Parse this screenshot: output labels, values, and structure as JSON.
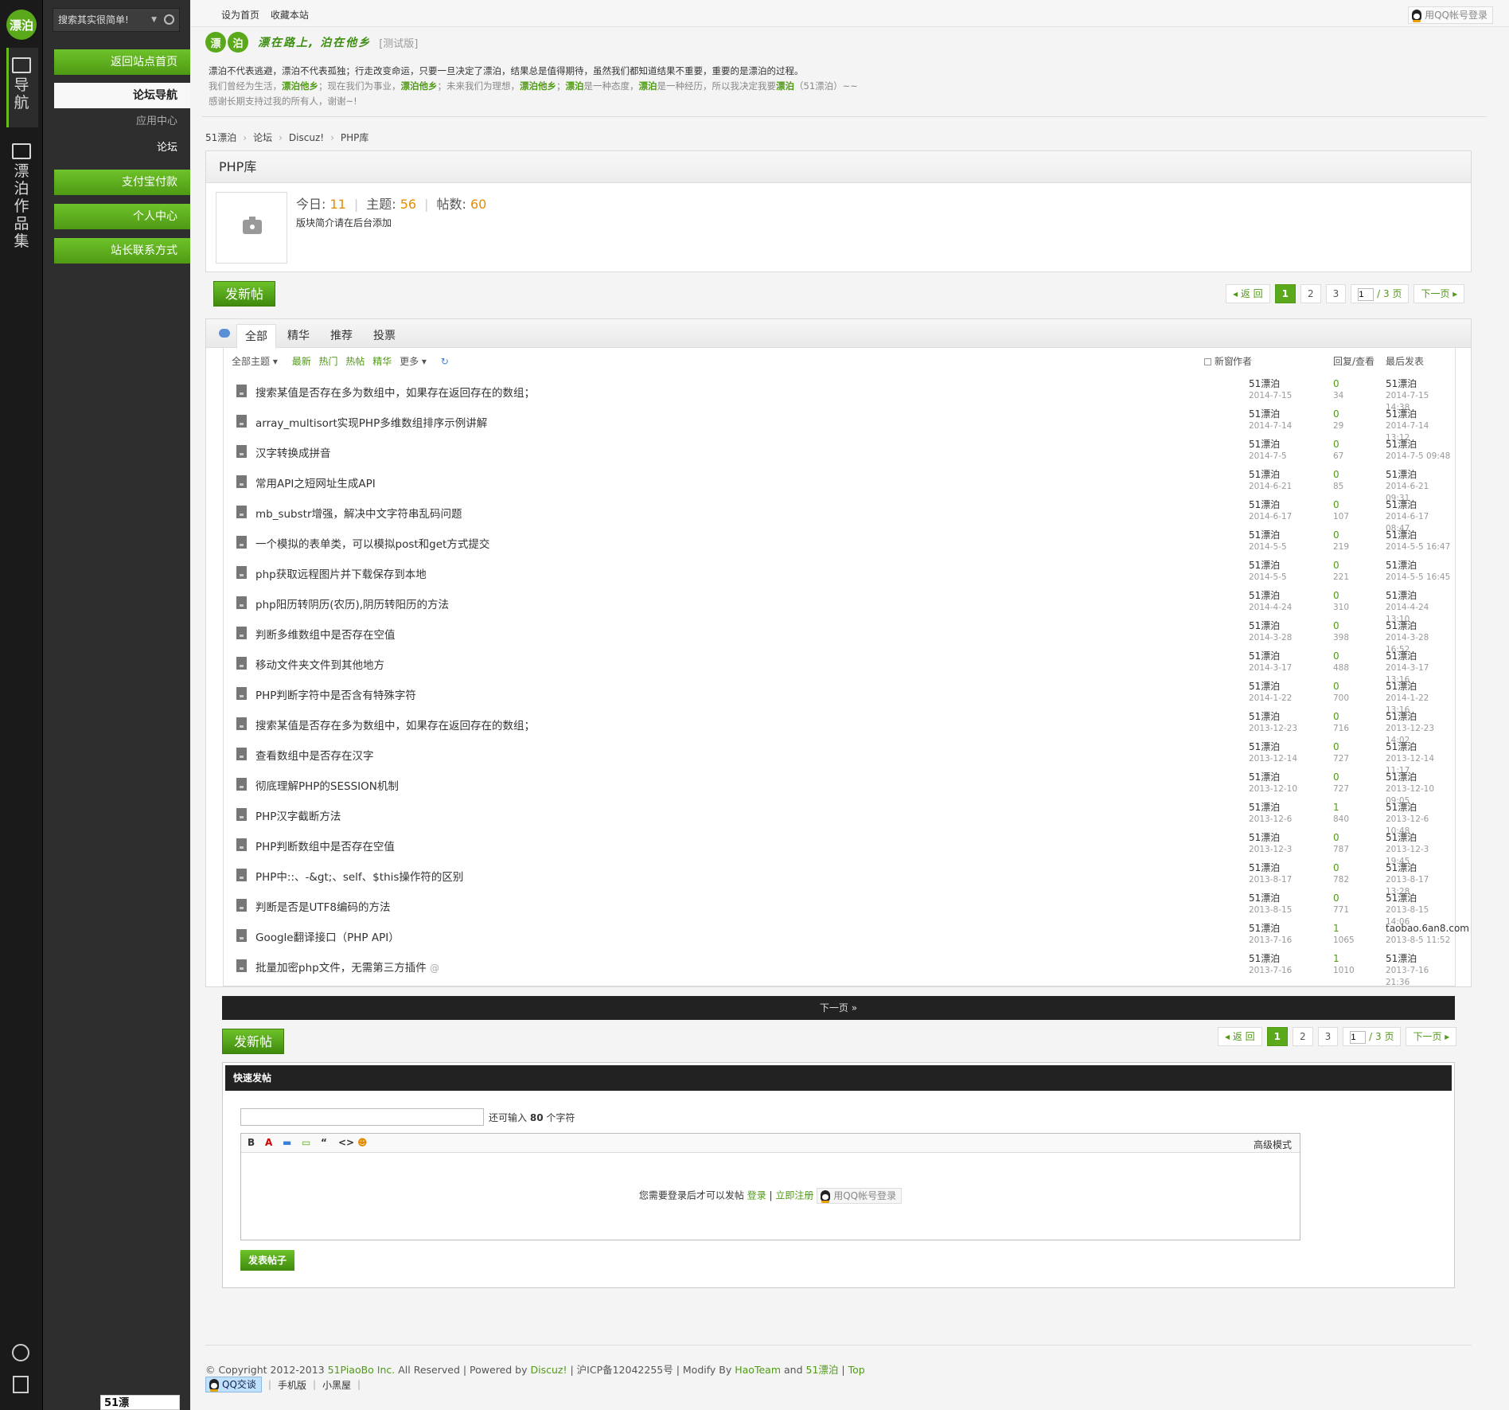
{
  "strip": {
    "logo_text": "漂泊",
    "nav_label": [
      "导",
      "航"
    ],
    "works_label": [
      "漂",
      "泊",
      "作",
      "品",
      "集"
    ]
  },
  "sidebar": {
    "search_placeholder": "搜索其实很简单!",
    "items": [
      {
        "label": "返回站点首页",
        "style": "green"
      },
      {
        "label": "论坛导航",
        "style": "white"
      },
      {
        "label": "应用中心",
        "style": "sub"
      },
      {
        "label": "论坛",
        "style": "sub-active"
      },
      {
        "label": "支付宝付款",
        "style": "green"
      },
      {
        "label": "个人中心",
        "style": "green"
      },
      {
        "label": "站长联系方式",
        "style": "green"
      }
    ],
    "bottom_thumb": "51漂"
  },
  "topbar": {
    "set_home": "设为首页",
    "bookmark": "收藏本站",
    "qq_login": "用QQ帐号登录"
  },
  "header": {
    "logo_chars": [
      "漂",
      "泊"
    ],
    "slogan": "漂在路上, 泊在他乡",
    "beta": "[测试版]",
    "notice_line1": "漂泊不代表逃避，漂泊不代表孤独；行走改变命运，只要一旦决定了漂泊，结果总是值得期待，虽然我们都知道结果不重要，重要的是漂泊的过程。",
    "notice_line2_parts": [
      "我们曾经为生活，",
      "漂泊他乡",
      "；现在我们为事业，",
      "漂泊他乡",
      "；未来我们为理想，",
      "漂泊他乡",
      "；",
      "漂泊",
      "是一种态度，",
      "漂泊",
      "是一种经历，所以我决定我要",
      "漂泊",
      "（51漂泊）~~"
    ],
    "notice_line3": "感谢长期支持过我的所有人，谢谢~!"
  },
  "breadcrumb": [
    "51漂泊",
    "论坛",
    "Discuz!",
    "PHP库"
  ],
  "forum": {
    "title": "PHP库",
    "today_label": "今日:",
    "today": "11",
    "threads_label": "主题:",
    "threads": "56",
    "posts_label": "帖数:",
    "posts": "60",
    "description": "版块简介请在后台添加"
  },
  "new_thread_label": "发新帖",
  "pager": {
    "back": "返 回",
    "pages": [
      "1",
      "2",
      "3"
    ],
    "current": "1",
    "input_value": "1",
    "total": "/ 3 页",
    "next": "下一页"
  },
  "tabs": [
    "全部",
    "精华",
    "推荐",
    "投票"
  ],
  "filters": {
    "all_topics": "全部主题",
    "links": [
      "最新",
      "热门",
      "热帖",
      "精华"
    ],
    "more": "更多",
    "new_window": "新窗",
    "col_author": "作者",
    "col_stats": "回复/查看",
    "col_last": "最后发表"
  },
  "threads": [
    {
      "title": "搜索某值是否存在多为数组中，如果存在返回存在的数组；",
      "author": "51漂泊",
      "date": "2014-7-15",
      "replies": "0",
      "views": "34",
      "last_user": "51漂泊",
      "last_time": "2014-7-15 14:38"
    },
    {
      "title": "array_multisort实现PHP多维数组排序示例讲解",
      "author": "51漂泊",
      "date": "2014-7-14",
      "replies": "0",
      "views": "29",
      "last_user": "51漂泊",
      "last_time": "2014-7-14 13:12"
    },
    {
      "title": "汉字转换成拼音",
      "author": "51漂泊",
      "date": "2014-7-5",
      "replies": "0",
      "views": "67",
      "last_user": "51漂泊",
      "last_time": "2014-7-5 09:48"
    },
    {
      "title": "常用API之短网址生成API",
      "author": "51漂泊",
      "date": "2014-6-21",
      "replies": "0",
      "views": "85",
      "last_user": "51漂泊",
      "last_time": "2014-6-21 09:31"
    },
    {
      "title": "mb_substr增强，解决中文字符串乱码问题",
      "author": "51漂泊",
      "date": "2014-6-17",
      "replies": "0",
      "views": "107",
      "last_user": "51漂泊",
      "last_time": "2014-6-17 08:47"
    },
    {
      "title": "一个模拟的表单类，可以模拟post和get方式提交",
      "author": "51漂泊",
      "date": "2014-5-5",
      "replies": "0",
      "views": "219",
      "last_user": "51漂泊",
      "last_time": "2014-5-5 16:47"
    },
    {
      "title": "php获取远程图片并下载保存到本地",
      "author": "51漂泊",
      "date": "2014-5-5",
      "replies": "0",
      "views": "221",
      "last_user": "51漂泊",
      "last_time": "2014-5-5 16:45"
    },
    {
      "title": "php阳历转阴历(农历),阴历转阳历的方法",
      "author": "51漂泊",
      "date": "2014-4-24",
      "replies": "0",
      "views": "310",
      "last_user": "51漂泊",
      "last_time": "2014-4-24 13:10"
    },
    {
      "title": "判断多维数组中是否存在空值",
      "author": "51漂泊",
      "date": "2014-3-28",
      "replies": "0",
      "views": "398",
      "last_user": "51漂泊",
      "last_time": "2014-3-28 16:52"
    },
    {
      "title": "移动文件夹文件到其他地方",
      "author": "51漂泊",
      "date": "2014-3-17",
      "replies": "0",
      "views": "488",
      "last_user": "51漂泊",
      "last_time": "2014-3-17 13:16"
    },
    {
      "title": "PHP判断字符中是否含有特殊字符",
      "author": "51漂泊",
      "date": "2014-1-22",
      "replies": "0",
      "views": "700",
      "last_user": "51漂泊",
      "last_time": "2014-1-22 13:16"
    },
    {
      "title": "搜索某值是否存在多为数组中，如果存在返回存在的数组；",
      "author": "51漂泊",
      "date": "2013-12-23",
      "replies": "0",
      "views": "716",
      "last_user": "51漂泊",
      "last_time": "2013-12-23 14:02"
    },
    {
      "title": "查看数组中是否存在汉字",
      "author": "51漂泊",
      "date": "2013-12-14",
      "replies": "0",
      "views": "727",
      "last_user": "51漂泊",
      "last_time": "2013-12-14 11:17"
    },
    {
      "title": "彻底理解PHP的SESSION机制",
      "author": "51漂泊",
      "date": "2013-12-10",
      "replies": "0",
      "views": "727",
      "last_user": "51漂泊",
      "last_time": "2013-12-10 09:05"
    },
    {
      "title": "PHP汉字截断方法",
      "author": "51漂泊",
      "date": "2013-12-6",
      "replies": "1",
      "views": "840",
      "last_user": "51漂泊",
      "last_time": "2013-12-6 10:48"
    },
    {
      "title": "PHP判断数组中是否存在空值",
      "author": "51漂泊",
      "date": "2013-12-3",
      "replies": "0",
      "views": "787",
      "last_user": "51漂泊",
      "last_time": "2013-12-3 19:45"
    },
    {
      "title": "PHP中::、-&gt;、self、$this操作符的区别",
      "author": "51漂泊",
      "date": "2013-8-17",
      "replies": "0",
      "views": "782",
      "last_user": "51漂泊",
      "last_time": "2013-8-17 13:28"
    },
    {
      "title": "判断是否是UTF8编码的方法",
      "author": "51漂泊",
      "date": "2013-8-15",
      "replies": "0",
      "views": "771",
      "last_user": "51漂泊",
      "last_time": "2013-8-15 14:06"
    },
    {
      "title": "Google翻译接口（PHP API）",
      "author": "51漂泊",
      "date": "2013-7-16",
      "replies": "1",
      "views": "1065",
      "last_user": "taobao.6an8.com",
      "last_time": "2013-8-5 11:52"
    },
    {
      "title": "批量加密php文件，无需第三方插件",
      "author": "51漂泊",
      "date": "2013-7-16",
      "replies": "1",
      "views": "1010",
      "last_user": "51漂泊",
      "last_time": "2013-7-16 21:36",
      "attach": "@"
    }
  ],
  "next_page_bar": "下一页 »",
  "quick_post": {
    "title": "快速发帖",
    "remain_prefix": "还可输入",
    "remain_count": "80",
    "remain_suffix": "个字符",
    "tools": [
      "B",
      "A",
      "▬",
      "▭",
      "“",
      "<>",
      "☻"
    ],
    "advanced": "高级模式",
    "login_msg": "您需要登录后才可以发帖",
    "login": "登录",
    "register": "立即注册",
    "qq_login": "用QQ帐号登录",
    "submit": "发表帖子"
  },
  "footer": {
    "copyright": "© Copyright 2012-2013",
    "company": "51PiaoBo Inc.",
    "reserved": "All Reserved | Powered by",
    "discuz": "Discuz!",
    "icp": "| 沪ICP备12042255号 | Modify By",
    "haoteam": "HaoTeam",
    "and": "and",
    "site": "51漂泊",
    "top": "Top",
    "qq_talk": "QQ交谈",
    "mobile": "手机版",
    "blackroom": "小黑屋"
  },
  "colors": {
    "accent_green": "#5aa91a",
    "count_orange": "#e38c00",
    "dark_bar": "#222222"
  }
}
